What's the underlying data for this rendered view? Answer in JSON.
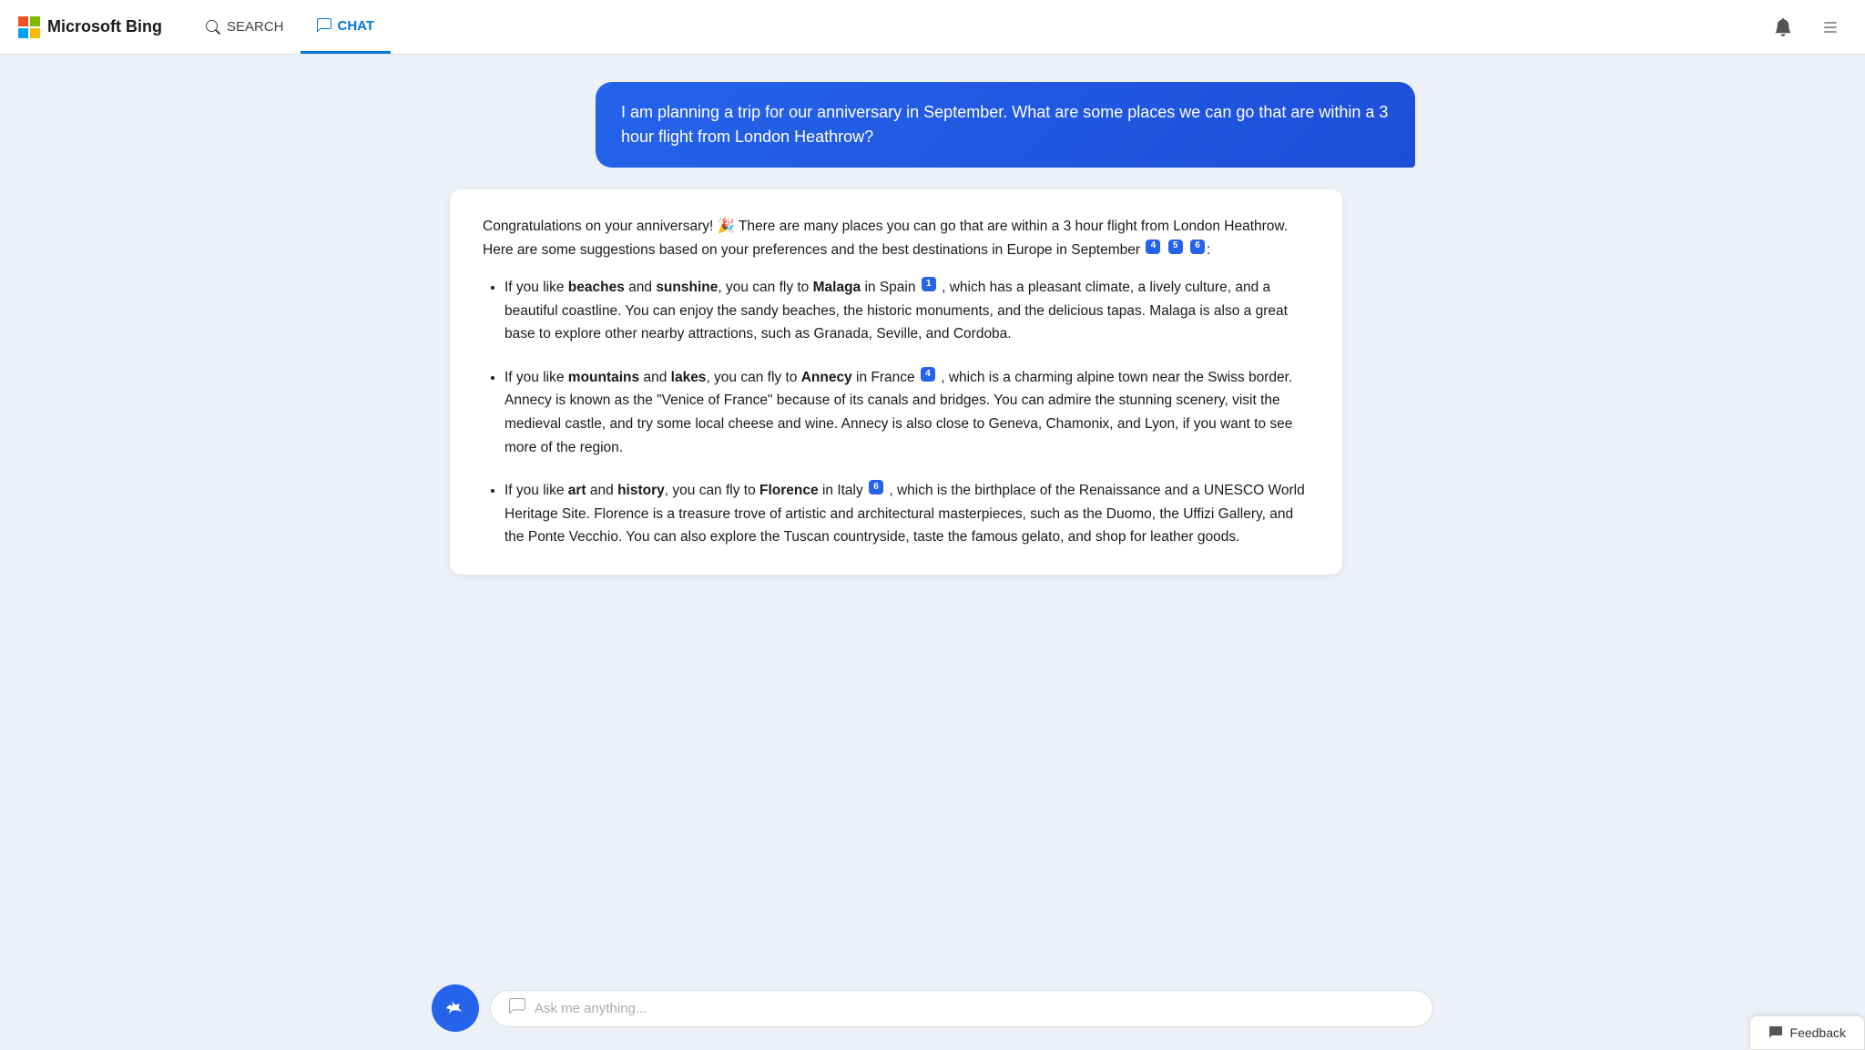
{
  "header": {
    "logo_text": "Microsoft Bing",
    "nav": [
      {
        "id": "search",
        "label": "SEARCH",
        "active": false
      },
      {
        "id": "chat",
        "label": "CHAT",
        "active": true
      }
    ]
  },
  "user_message": "I am planning a trip for our anniversary in September. What are some places we can go that are within a 3 hour flight from London Heathrow?",
  "ai_response": {
    "intro": "Congratulations on your anniversary! 🎉 There are many places you can go that are within a 3 hour flight from London Heathrow. Here are some suggestions based on your preferences and the best destinations in Europe in September",
    "intro_citations": [
      "4",
      "5",
      "6"
    ],
    "items": [
      {
        "bold_terms": [
          "beaches",
          "sunshine"
        ],
        "city": "Malaga",
        "country": "Spain",
        "citation": "1",
        "description": "which has a pleasant climate, a lively culture, and a beautiful coastline. You can enjoy the sandy beaches, the historic monuments, and the delicious tapas. Malaga is also a great base to explore other nearby attractions, such as Granada, Seville, and Cordoba."
      },
      {
        "bold_terms": [
          "mountains",
          "lakes"
        ],
        "city": "Annecy",
        "country": "France",
        "citation": "4",
        "description": "which is a charming alpine town near the Swiss border. Annecy is known as the \"Venice of France\" because of its canals and bridges. You can admire the stunning scenery, visit the medieval castle, and try some local cheese and wine. Annecy is also close to Geneva, Chamonix, and Lyon, if you want to see more of the region."
      },
      {
        "bold_terms": [
          "art",
          "history"
        ],
        "city": "Florence",
        "country": "Italy",
        "citation": "6",
        "description": "which is the birthplace of the Renaissance and a UNESCO World Heritage Site. Florence is a treasure trove of artistic and architectural masterpieces, such as the Duomo, the Uffizi Gallery, and the Ponte Vecchio. You can also explore the Tuscan countryside, taste the famous gelato, and shop for leather goods."
      }
    ]
  },
  "input_placeholder": "Ask me anything...",
  "feedback_label": "Feedback"
}
